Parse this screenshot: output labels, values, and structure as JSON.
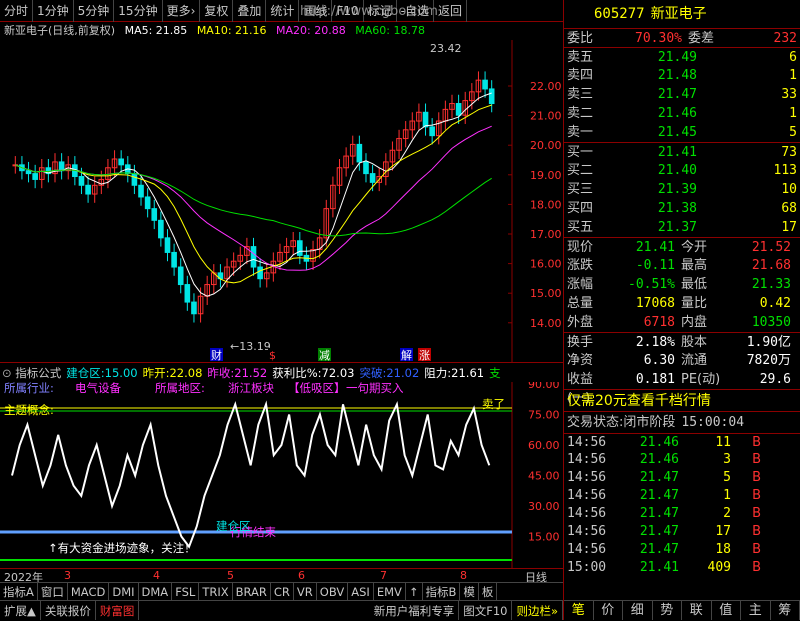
{
  "toolbar": {
    "items": [
      "分时",
      "1分钟",
      "5分钟",
      "15分钟",
      "更多›",
      "复权",
      "叠加",
      "统计",
      "画线",
      "F10",
      "标记",
      "-自选",
      "返回"
    ],
    "watermark": "http://www.cgbo.com"
  },
  "chart_info": {
    "title": "新亚电子(日线,前复权)",
    "ma5": "MA5: 21.85",
    "ma10": "MA10: 21.16",
    "ma20": "MA20: 20.88",
    "ma60": "MA60: 18.78",
    "peak_label": "23.42",
    "low_label": "13.19"
  },
  "price_axis": [
    "22.00",
    "21.00",
    "20.00",
    "19.00",
    "18.00",
    "17.00",
    "16.00",
    "15.00",
    "14.00"
  ],
  "event_markers": [
    {
      "text": "财",
      "color": "#ffffff",
      "bg": "#0000c0"
    },
    {
      "text": "$",
      "color": "#ff3030",
      "bg": "#000"
    },
    {
      "text": "减",
      "color": "#ffffff",
      "bg": "#008000"
    },
    {
      "text": "解",
      "color": "#ffffff",
      "bg": "#0000c0"
    },
    {
      "text": "涨",
      "color": "#ffffff",
      "bg": "#c00000"
    }
  ],
  "indicator_bar": {
    "name": "指标公式",
    "fields": [
      {
        "label": "建仓区:",
        "value": "15.00",
        "color": "#00e5e5"
      },
      {
        "label": "昨开:",
        "value": "22.08",
        "color": "#ffff00"
      },
      {
        "label": "昨收:",
        "value": "21.52",
        "color": "#ff30ff"
      },
      {
        "label": "获利比%:",
        "value": "72.03",
        "color": "#ffffff"
      },
      {
        "label": "突破:",
        "value": "21.02",
        "color": "#3060ff"
      },
      {
        "label": "阻力:",
        "value": "21.61",
        "color": "#ffffff"
      },
      {
        "label": "支",
        "value": "",
        "color": "#00e000"
      }
    ]
  },
  "ind_labels": {
    "industry": "所属行业:",
    "industry_val": "电气设备",
    "region": "所属地区:",
    "region_val": "浙江板块",
    "low_tag": "【低吸区】",
    "buy_tag": "一句期买入",
    "theme": "主题概念:",
    "sell": "卖了",
    "note": "↑有大资金进场迹象，关注！",
    "end": "行情结束",
    "entry": "建仓区"
  },
  "ind_axis": [
    "90.00",
    "75.00",
    "60.00",
    "45.00",
    "30.00",
    "15.00"
  ],
  "date_axis": [
    "2022年",
    "3",
    "4",
    "5",
    "6",
    "7",
    "8"
  ],
  "period_label": "日线",
  "tabs1": [
    "指标A",
    "窗口",
    "MACD",
    "DMI",
    "DMA",
    "FSL",
    "TRIX",
    "BRAR",
    "CR",
    "VR",
    "OBV",
    "ASI",
    "EMV",
    "↑",
    "指标B",
    "模",
    "板"
  ],
  "tabs2": [
    "扩展▲",
    "关联报价",
    "财富图"
  ],
  "tabs2_right": [
    "新用户福利专享",
    "图文F10",
    "则边栏»"
  ],
  "quote": {
    "code": "605277",
    "name": "新亚电子",
    "weibi_label": "委比",
    "weibi": "70.30%",
    "weicha_label": "委差",
    "weicha": "232",
    "asks": [
      {
        "l": "卖五",
        "p": "21.49",
        "v": "6"
      },
      {
        "l": "卖四",
        "p": "21.48",
        "v": "1"
      },
      {
        "l": "卖三",
        "p": "21.47",
        "v": "33"
      },
      {
        "l": "卖二",
        "p": "21.46",
        "v": "1"
      },
      {
        "l": "卖一",
        "p": "21.45",
        "v": "5"
      }
    ],
    "bids": [
      {
        "l": "买一",
        "p": "21.41",
        "v": "73"
      },
      {
        "l": "买二",
        "p": "21.40",
        "v": "113"
      },
      {
        "l": "买三",
        "p": "21.39",
        "v": "10"
      },
      {
        "l": "买四",
        "p": "21.38",
        "v": "68"
      },
      {
        "l": "买五",
        "p": "21.37",
        "v": "17"
      }
    ],
    "stats": [
      [
        {
          "l": "现价",
          "v": "21.41",
          "c": "green"
        },
        {
          "l": "今开",
          "v": "21.52",
          "c": "red"
        }
      ],
      [
        {
          "l": "涨跌",
          "v": "-0.11",
          "c": "green"
        },
        {
          "l": "最高",
          "v": "21.68",
          "c": "red"
        }
      ],
      [
        {
          "l": "涨幅",
          "v": "-0.51%",
          "c": "green"
        },
        {
          "l": "最低",
          "v": "21.33",
          "c": "green"
        }
      ],
      [
        {
          "l": "总量",
          "v": "17068",
          "c": "yellow"
        },
        {
          "l": "量比",
          "v": "0.42",
          "c": "yellow"
        }
      ],
      [
        {
          "l": "外盘",
          "v": "6718",
          "c": "red"
        },
        {
          "l": "内盘",
          "v": "10350",
          "c": "green"
        }
      ]
    ],
    "stats2": [
      [
        {
          "l": "换手",
          "v": "2.18%"
        },
        {
          "l": "股本",
          "v": "1.90亿"
        }
      ],
      [
        {
          "l": "净资",
          "v": "6.30"
        },
        {
          "l": "流通",
          "v": "7820万"
        }
      ],
      [
        {
          "l": "收益(一)",
          "v": "0.181"
        },
        {
          "l": "PE(动)",
          "v": "29.6"
        }
      ]
    ],
    "promo": "仅需20元查看千档行情",
    "status_label": "交易状态:",
    "status": "闭市阶段",
    "status_time": "15:00:04",
    "ticks": [
      {
        "t": "14:56",
        "p": "21.46",
        "v": "11",
        "s": "B"
      },
      {
        "t": "14:56",
        "p": "21.46",
        "v": "3",
        "s": "B"
      },
      {
        "t": "14:56",
        "p": "21.47",
        "v": "5",
        "s": "B"
      },
      {
        "t": "14:56",
        "p": "21.47",
        "v": "1",
        "s": "B"
      },
      {
        "t": "14:56",
        "p": "21.47",
        "v": "2",
        "s": "B"
      },
      {
        "t": "14:56",
        "p": "21.47",
        "v": "17",
        "s": "B"
      },
      {
        "t": "14:56",
        "p": "21.47",
        "v": "18",
        "s": "B"
      },
      {
        "t": "15:00",
        "p": "21.41",
        "v": "409",
        "s": "B"
      }
    ],
    "bottom_tabs": [
      "笔",
      "价",
      "细",
      "势",
      "联",
      "值",
      "主",
      "筹"
    ]
  },
  "colors": {
    "up": "#ff3030",
    "down": "#00e5e5",
    "ma5": "#ffffff",
    "ma10": "#ffff00",
    "ma20": "#ff30ff",
    "ma60": "#00e000"
  }
}
